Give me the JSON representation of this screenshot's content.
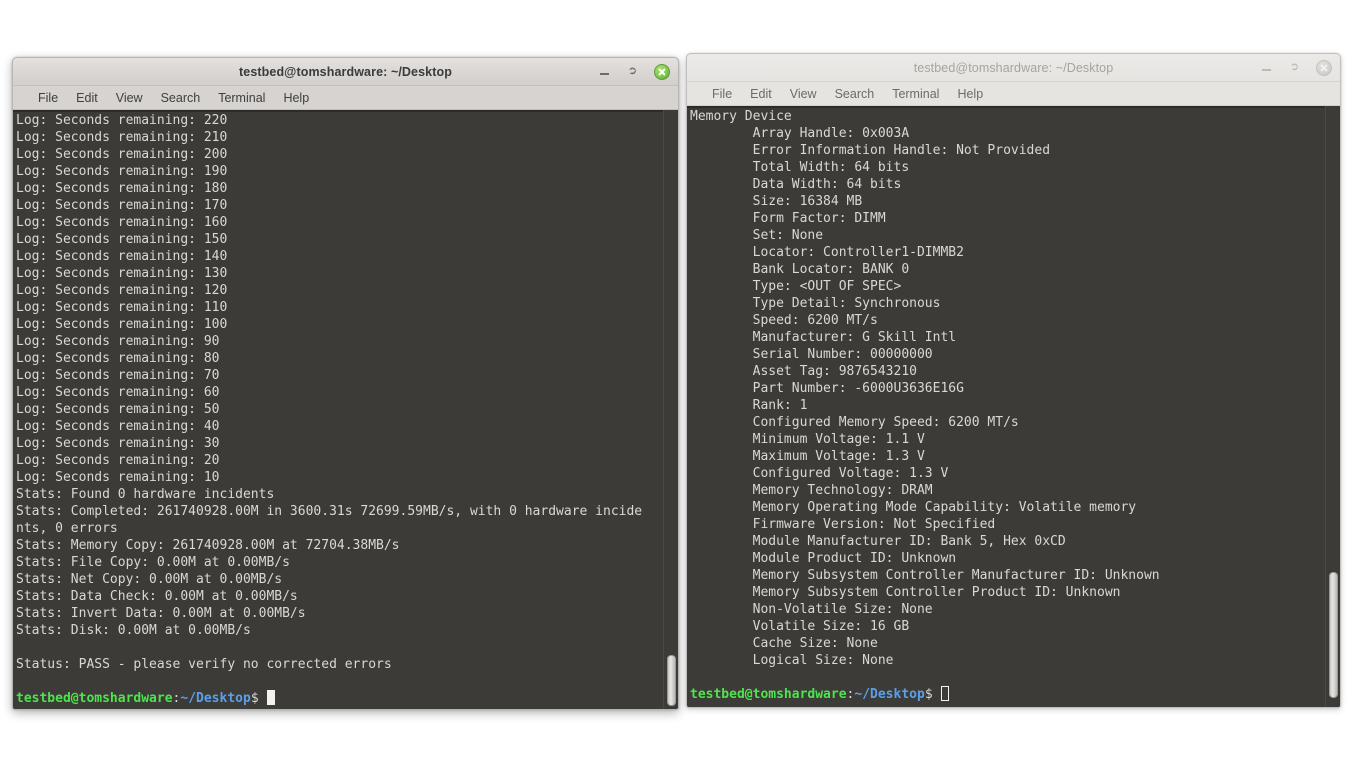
{
  "desktop": {
    "background_color": "#ffffff"
  },
  "windows": [
    {
      "id": "left",
      "title": "testbed@tomshardware: ~/Desktop",
      "state": "active",
      "menu": [
        "File",
        "Edit",
        "View",
        "Search",
        "Terminal",
        "Help"
      ],
      "buttons": {
        "minimize": "minimize",
        "maximize": "restore",
        "close": "close"
      },
      "terminal": {
        "background_color": "#3c3b37",
        "text_color": "#d8d8d4",
        "lines": [
          "Log: Seconds remaining: 220",
          "Log: Seconds remaining: 210",
          "Log: Seconds remaining: 200",
          "Log: Seconds remaining: 190",
          "Log: Seconds remaining: 180",
          "Log: Seconds remaining: 170",
          "Log: Seconds remaining: 160",
          "Log: Seconds remaining: 150",
          "Log: Seconds remaining: 140",
          "Log: Seconds remaining: 130",
          "Log: Seconds remaining: 120",
          "Log: Seconds remaining: 110",
          "Log: Seconds remaining: 100",
          "Log: Seconds remaining: 90",
          "Log: Seconds remaining: 80",
          "Log: Seconds remaining: 70",
          "Log: Seconds remaining: 60",
          "Log: Seconds remaining: 50",
          "Log: Seconds remaining: 40",
          "Log: Seconds remaining: 30",
          "Log: Seconds remaining: 20",
          "Log: Seconds remaining: 10",
          "Stats: Found 0 hardware incidents",
          "Stats: Completed: 261740928.00M in 3600.31s 72699.59MB/s, with 0 hardware incide",
          "nts, 0 errors",
          "Stats: Memory Copy: 261740928.00M at 72704.38MB/s",
          "Stats: File Copy: 0.00M at 0.00MB/s",
          "Stats: Net Copy: 0.00M at 0.00MB/s",
          "Stats: Data Check: 0.00M at 0.00MB/s",
          "Stats: Invert Data: 0.00M at 0.00MB/s",
          "Stats: Disk: 0.00M at 0.00MB/s",
          "",
          "Status: PASS - please verify no corrected errors",
          ""
        ],
        "prompt": {
          "user_host": "testbed@tomshardware",
          "separator": ":",
          "path": "~/Desktop",
          "dollar": "$",
          "cursor": "filled-block"
        },
        "scrollbar": {
          "thumb_top_pct": 91,
          "thumb_height_pct": 8.5
        }
      }
    },
    {
      "id": "right",
      "title": "testbed@tomshardware: ~/Desktop",
      "state": "inactive",
      "menu": [
        "File",
        "Edit",
        "View",
        "Search",
        "Terminal",
        "Help"
      ],
      "buttons": {
        "minimize": "minimize",
        "maximize": "restore",
        "close": "close"
      },
      "terminal": {
        "background_color": "#3c3b37",
        "text_color": "#d8d8d4",
        "lines": [
          "Memory Device",
          "        Array Handle: 0x003A",
          "        Error Information Handle: Not Provided",
          "        Total Width: 64 bits",
          "        Data Width: 64 bits",
          "        Size: 16384 MB",
          "        Form Factor: DIMM",
          "        Set: None",
          "        Locator: Controller1-DIMMB2",
          "        Bank Locator: BANK 0",
          "        Type: <OUT OF SPEC>",
          "        Type Detail: Synchronous",
          "        Speed: 6200 MT/s",
          "        Manufacturer: G Skill Intl",
          "        Serial Number: 00000000",
          "        Asset Tag: 9876543210",
          "        Part Number: -6000U3636E16G",
          "        Rank: 1",
          "        Configured Memory Speed: 6200 MT/s",
          "        Minimum Voltage: 1.1 V",
          "        Maximum Voltage: 1.3 V",
          "        Configured Voltage: 1.3 V",
          "        Memory Technology: DRAM",
          "        Memory Operating Mode Capability: Volatile memory",
          "        Firmware Version: Not Specified",
          "        Module Manufacturer ID: Bank 5, Hex 0xCD",
          "        Module Product ID: Unknown",
          "        Memory Subsystem Controller Manufacturer ID: Unknown",
          "        Memory Subsystem Controller Product ID: Unknown",
          "        Non-Volatile Size: None",
          "        Volatile Size: 16 GB",
          "        Cache Size: None",
          "        Logical Size: None",
          ""
        ],
        "prompt": {
          "user_host": "testbed@tomshardware",
          "separator": ":",
          "path": "~/Desktop",
          "dollar": "$",
          "cursor": "hollow-block"
        },
        "scrollbar": {
          "thumb_top_pct": 77.5,
          "thumb_height_pct": 21
        }
      }
    }
  ]
}
